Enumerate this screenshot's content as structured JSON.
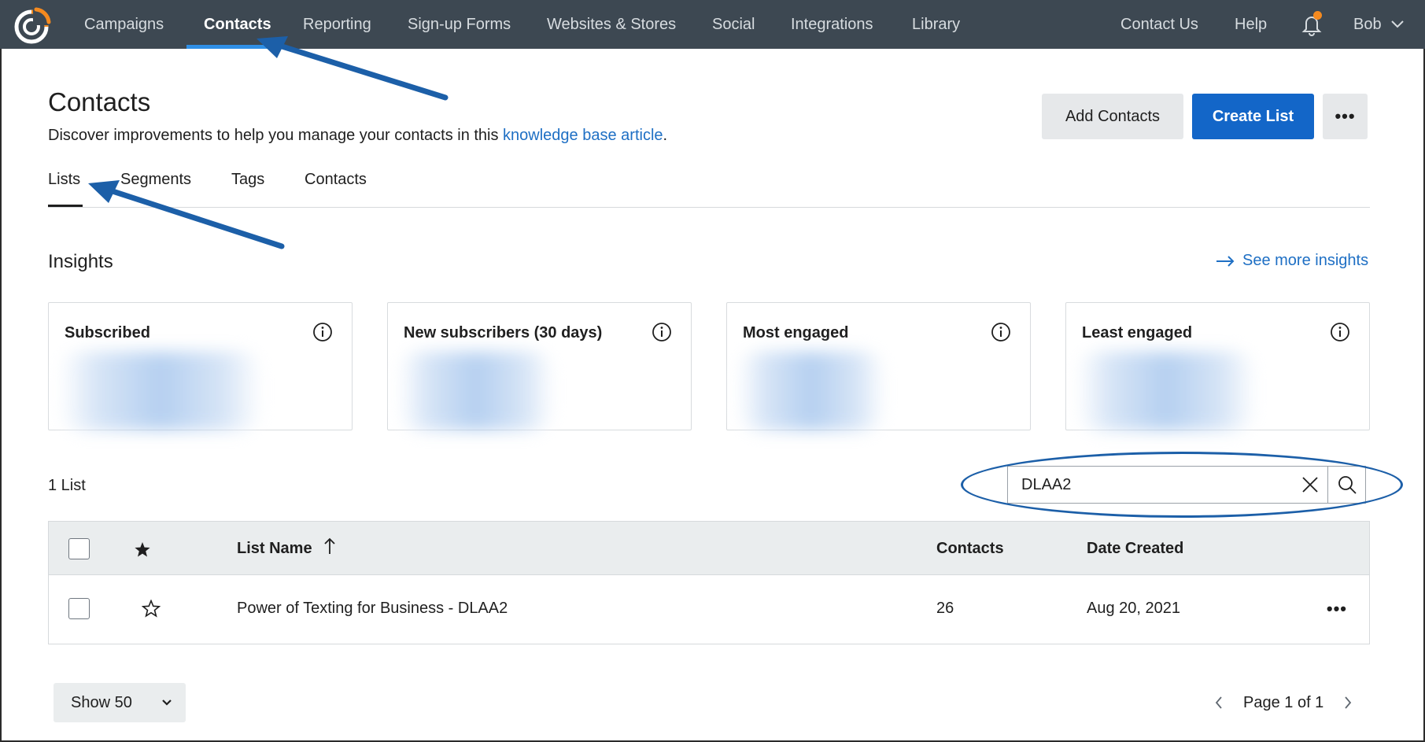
{
  "topnav": {
    "items": [
      {
        "label": "Campaigns"
      },
      {
        "label": "Contacts"
      },
      {
        "label": "Reporting"
      },
      {
        "label": "Sign-up Forms"
      },
      {
        "label": "Websites & Stores"
      },
      {
        "label": "Social"
      },
      {
        "label": "Integrations"
      },
      {
        "label": "Library"
      }
    ],
    "active": "Contacts",
    "right_items": [
      {
        "label": "Contact Us"
      },
      {
        "label": "Help"
      }
    ],
    "user_name": "Bob",
    "icons": {
      "logo": "brand-logo-icon",
      "notifications": "bell-icon",
      "user_menu": "chevron-down-icon"
    },
    "colors": {
      "bar": "#3d4852",
      "active_underline": "#2f8fe6",
      "notification_dot": "#f58a1f",
      "logo_orange": "#f58a1f"
    }
  },
  "header": {
    "title": "Contacts",
    "subtitle_prefix": "Discover improvements to help you manage your contacts in this ",
    "subtitle_link": "knowledge base article",
    "subtitle_suffix": ".",
    "add_contacts_label": "Add Contacts",
    "create_list_label": "Create List",
    "more_label": "•••"
  },
  "tabs": [
    {
      "label": "Lists",
      "active": true
    },
    {
      "label": "Segments"
    },
    {
      "label": "Tags"
    },
    {
      "label": "Contacts"
    }
  ],
  "insights": {
    "title": "Insights",
    "see_more_label": "See more insights",
    "cards": [
      {
        "title": "Subscribed"
      },
      {
        "title": "New subscribers (30 days)"
      },
      {
        "title": "Most engaged"
      },
      {
        "title": "Least engaged"
      }
    ]
  },
  "lists": {
    "count_label": "1 List",
    "search_value": "DLAA2",
    "columns": [
      "List Name",
      "Contacts",
      "Date Created"
    ],
    "sort_icon": "arrow-up-icon",
    "rows": [
      {
        "name": "Power of Texting for Business - DLAA2",
        "contacts": "26",
        "date_created": "Aug 20, 2021",
        "more_label": "•••"
      }
    ]
  },
  "footer": {
    "page_size_label": "Show 50",
    "page_label": "Page 1 of 1"
  },
  "colors": {
    "primary_button": "#1366c8",
    "link": "#1e6fc4",
    "annotation": "#1c5fa8"
  }
}
